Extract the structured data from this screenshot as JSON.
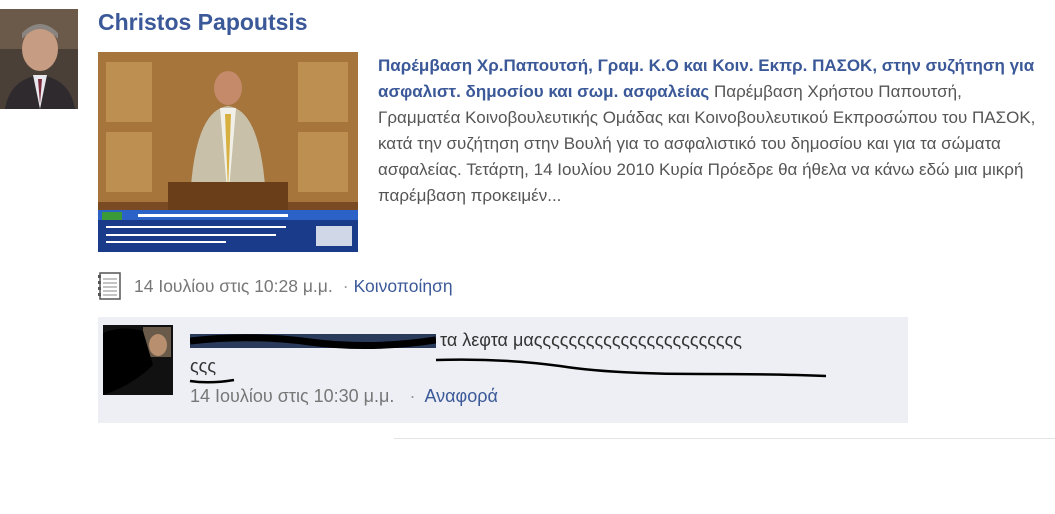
{
  "post": {
    "author": "Christos Papoutsis",
    "attachment": {
      "title": "Παρέμβαση Χρ.Παπουτσή, Γραμ. Κ.Ο και Κοιν. Εκπρ. ΠΑΣΟΚ, στην συζήτηση για ασφαλιστ. δημοσίου και σωμ. ασφαλείας",
      "description": " Παρέμβαση Χρήστου Παπουτσή, Γραμματέα Κοινοβουλευτικής Ομάδας και Κοινοβουλευτικού Εκπροσώπου του ΠΑΣΟΚ, κατά την συζήτηση στην Βουλή για το ασφαλιστικό του δημοσίου και για τα σώματα ασφαλείας. Τετάρτη, 14 Ιουλίου 2010 Κυρία Πρόεδρε θα ήθελα να κάνω εδώ μια μικρή παρέμβαση προκειμέν..."
    },
    "timestamp": "14 Ιουλίου στις 10:28 μ.μ.",
    "share_label": "Κοινοποίηση"
  },
  "comment": {
    "text_line1": "τα λεφτα μαςςςςςςςςςςςςςςςςςςςςςςςς",
    "text_line2": "ςςς",
    "timestamp": "14 Ιουλίου στις 10:30 μ.μ.",
    "report_label": "Αναφορά"
  },
  "icons": {
    "note": "note-icon"
  }
}
